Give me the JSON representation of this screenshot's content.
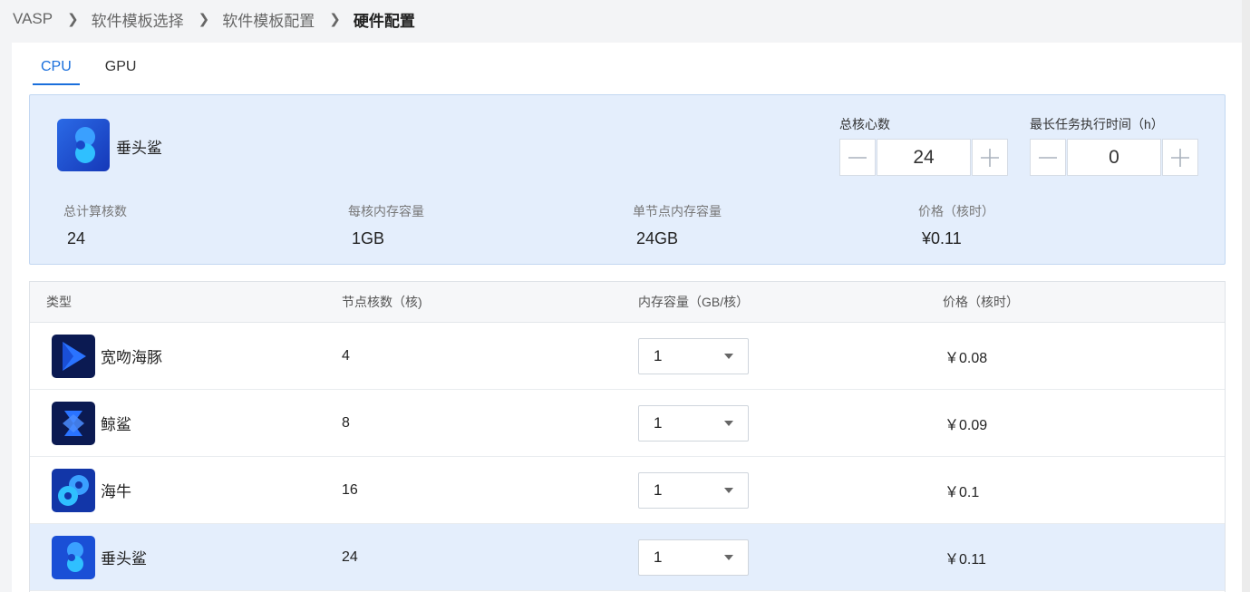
{
  "breadcrumb": {
    "items": [
      "VASP",
      "软件模板选择",
      "软件模板配置"
    ],
    "current": "硬件配置"
  },
  "tabs": [
    {
      "label": "CPU",
      "active": true
    },
    {
      "label": "GPU",
      "active": false
    }
  ],
  "summary": {
    "name": "垂头鲨",
    "icon": "hammerhead-logo-icon",
    "total_cores": {
      "label": "总核心数",
      "value": "24"
    },
    "max_time": {
      "label": "最长任务执行时间（h）",
      "value": "0"
    },
    "stats": [
      {
        "label": "总计算核数",
        "value": "24"
      },
      {
        "label": "每核内存容量",
        "value": "1GB"
      },
      {
        "label": "单节点内存容量",
        "value": "24GB"
      },
      {
        "label": "价格（核时）",
        "value": "¥0.11"
      }
    ]
  },
  "table": {
    "headers": [
      "类型",
      "节点核数（核)",
      "内存容量（GB/核）",
      "价格（核时）"
    ],
    "rows": [
      {
        "icon": "dolphin-play-icon",
        "type": "宽吻海豚",
        "cores": "4",
        "mem": "1",
        "price": "￥0.08",
        "selected": false
      },
      {
        "icon": "whale-shark-icon",
        "type": "鲸鲨",
        "cores": "8",
        "mem": "1",
        "price": "￥0.09",
        "selected": false
      },
      {
        "icon": "manatee-icon",
        "type": "海牛",
        "cores": "16",
        "mem": "1",
        "price": "￥0.1",
        "selected": false
      },
      {
        "icon": "hammerhead-logo-icon",
        "type": "垂头鲨",
        "cores": "24",
        "mem": "1",
        "price": "￥0.11",
        "selected": true
      }
    ]
  },
  "colors": {
    "accent": "#1a6fdc",
    "selected_bg": "#e4eefc"
  }
}
